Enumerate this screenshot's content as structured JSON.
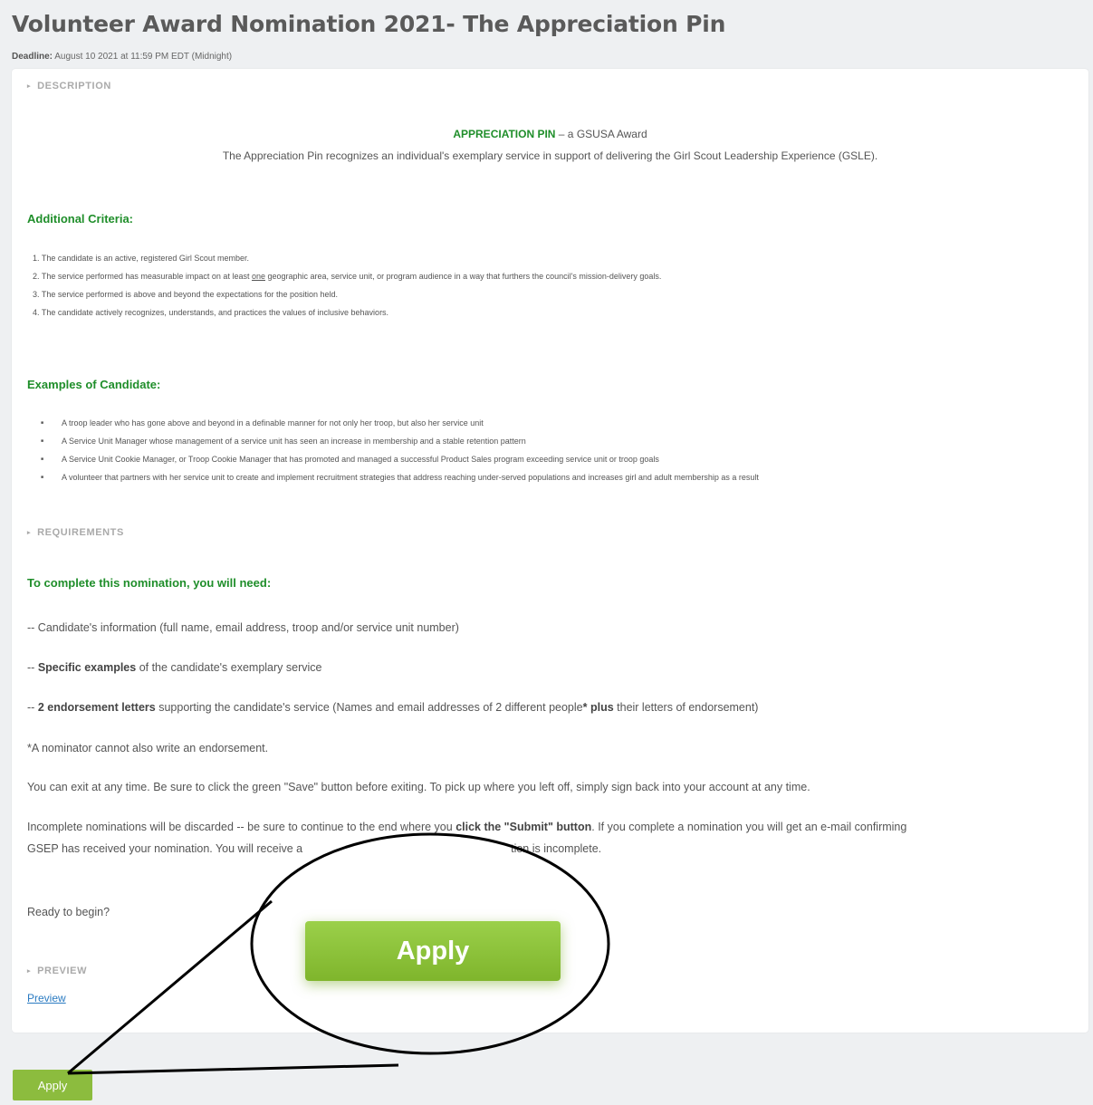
{
  "page": {
    "title": "Volunteer Award Nomination 2021- The Appreciation Pin",
    "deadline_label": "Deadline:",
    "deadline_value": " August 10 2021 at 11:59 PM EDT (Midnight)"
  },
  "description": {
    "section_label": "DESCRIPTION",
    "pin_title": "APPRECIATION PIN",
    "pin_suffix": " – a GSUSA Award",
    "pin_text": "The Appreciation Pin recognizes an individual's exemplary service in support of delivering the Girl Scout Leadership Experience (GSLE).",
    "criteria_heading": "Additional Criteria:",
    "criteria": [
      "1. The candidate is an active, registered Girl Scout member.",
      "2. The service performed has measurable impact on at least ",
      "3. The service performed is above and beyond the expectations for the position held.",
      "4. The candidate actively recognizes, understands, and practices the values of inclusive behaviors."
    ],
    "criteria_2_underlined": "one",
    "criteria_2_rest": " geographic area, service unit, or program audience in a way that furthers the council's mission-delivery goals.",
    "examples_heading": "Examples of Candidate:",
    "examples": [
      "A troop leader who has gone above and beyond in a definable manner for not only her troop, but also her service unit",
      "A Service Unit Manager whose management of a service unit has seen an increase in membership and a stable retention pattern",
      "A Service Unit Cookie Manager, or Troop Cookie Manager that has promoted and managed a successful Product Sales program exceeding service unit or troop goals",
      "A volunteer that partners with her service unit to create and implement recruitment strategies that address reaching under-served populations and increases girl and adult membership as a result"
    ]
  },
  "requirements": {
    "section_label": "REQUIREMENTS",
    "heading": "To complete this nomination, you will need:",
    "item1": "-- Candidate's information (full name, email address, troop and/or service unit number)",
    "item2_prefix": "-- ",
    "item2_bold": "Specific examples",
    "item2_rest": " of the candidate's exemplary service",
    "item3_prefix": "-- ",
    "item3_bold": "2 endorsement letters",
    "item3_mid": " supporting the candidate's service (Names and email addresses of 2 different people",
    "item3_star": "*",
    "item3_plus": "plus",
    "item3_rest": " their letters of endorsement)",
    "note": "*A nominator cannot also write an endorsement.",
    "exit_text": "You can exit at any time.  Be sure to click the green \"Save\" button before exiting.  To pick up where you left off, simply sign back into your account at any time.",
    "incomplete_1": "Incomplete nominations will be discarded -- be sure to continue to the end where you ",
    "incomplete_bold": "click the \"Submit\" button",
    "incomplete_2": ".  If you complete a nomination you will get an e-mail confirming",
    "incomplete_3a": "GSEP has received your nomination.  You will receive a",
    "incomplete_3b": "tion is incomplete.",
    "ready": "Ready to begin?"
  },
  "preview": {
    "section_label": "PREVIEW",
    "link": "Preview"
  },
  "actions": {
    "apply_label": "Apply",
    "callout_apply_label": "Apply"
  }
}
